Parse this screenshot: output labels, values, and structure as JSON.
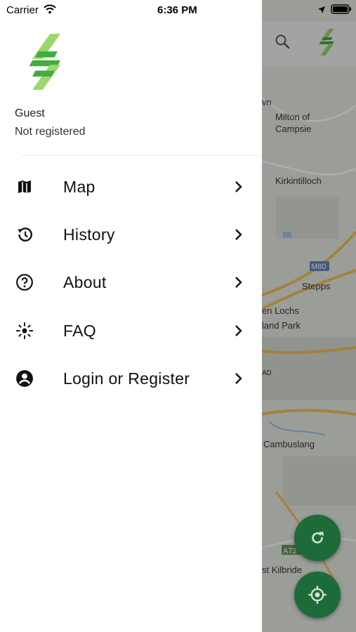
{
  "status_bar": {
    "carrier": "Carrier",
    "time": "6:36 PM"
  },
  "user": {
    "name": "Guest",
    "status": "Not registered"
  },
  "menu": [
    {
      "label": "Map",
      "icon": "map-icon"
    },
    {
      "label": "History",
      "icon": "history-icon"
    },
    {
      "label": "About",
      "icon": "help-circle-icon"
    },
    {
      "label": "FAQ",
      "icon": "sparkle-icon"
    },
    {
      "label": "Login or Register",
      "icon": "account-circle-icon"
    }
  ],
  "map": {
    "labels": [
      "vn",
      "Milton of",
      "Campsie",
      "Kirkintilloch",
      "M80",
      "Stepps",
      "en Lochs",
      "land Park",
      "AD",
      "Cambuslang",
      "A72",
      "st Kilbride"
    ]
  },
  "colors": {
    "brand_green": "#1e6b3a",
    "logo_green": "#3fae3b",
    "logo_light": "#9bd86b"
  }
}
